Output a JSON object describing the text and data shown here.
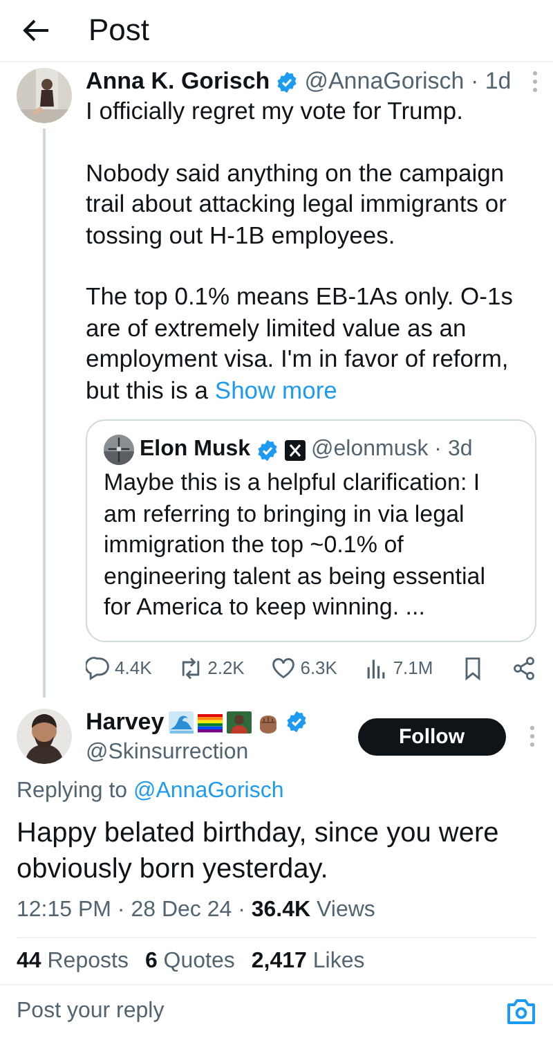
{
  "header": {
    "title": "Post"
  },
  "post": {
    "name": "Anna K. Gorisch",
    "verified": true,
    "meta": "@AnnaGorisch · 1d",
    "paragraphs": [
      "I officially regret my vote for Trump.",
      "Nobody said anything on the campaign trail about attacking legal immigrants or tossing out H-1B employees.",
      "The top 0.1% means EB-1As only. O-1s are of extremely limited value as an employment visa. I'm in favor of reform, but this is a "
    ],
    "show_more": "Show more",
    "quote": {
      "name": "Elon Musk",
      "verified": true,
      "affiliate": true,
      "meta": "@elonmusk · 3d",
      "text": "Maybe this is a helpful clarification: I am referring to bringing in via legal immigration the top ~0.1% of engineering talent as being essential for America to keep winning. ..."
    },
    "actions": [
      {
        "kind": "reply",
        "count": "4.4K"
      },
      {
        "kind": "repost",
        "count": "2.2K"
      },
      {
        "kind": "like",
        "count": "6.3K"
      },
      {
        "kind": "views",
        "count": "7.1M"
      },
      {
        "kind": "bookmark"
      },
      {
        "kind": "share"
      }
    ]
  },
  "reply": {
    "name": "Harvey",
    "emoji": [
      {
        "kind": "wave"
      },
      {
        "kind": "flag"
      },
      {
        "kind": "person"
      },
      {
        "kind": "fist"
      }
    ],
    "verified": true,
    "handle": "@Skinsurrection",
    "follow": "Follow",
    "replying_prefix": "Replying to",
    "replying_to": "@AnnaGorisch",
    "text": "Happy belated birthday,  since you were obviously born yesterday.",
    "timestamp": "12:15 PM · 28 Dec 24 · **36.4K** Views",
    "stats": [
      "**44** Reposts",
      "**6** Quotes",
      "**2,417** Likes"
    ]
  },
  "composer": {
    "placeholder": "Post your reply"
  }
}
